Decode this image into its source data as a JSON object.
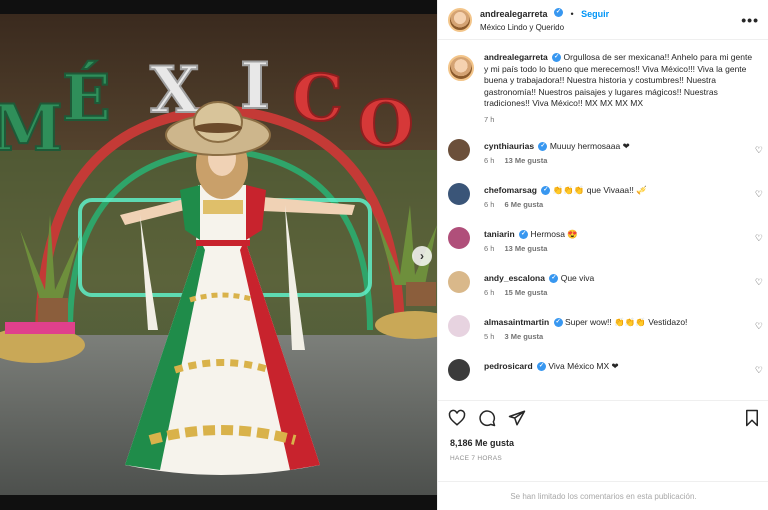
{
  "post": {
    "username": "andrealegarreta",
    "follow_label": "Seguir",
    "location": "México Lindo y Querido",
    "more_label": "•••",
    "carousel_next": "›"
  },
  "caption": {
    "username": "andrealegarreta",
    "text": "Orgullosa de ser mexicana!! Anhelo para mi gente y mi país todo lo bueno que merecemos!! Viva México!!! Viva la gente buena y trabajadora!! Nuestra historia y costumbres!! Nuestra gastronomía!! Nuestros paisajes y lugares mágicos!! Nuestras tradiciones!! Viva México!! MX MX MX MX",
    "time": "7 h"
  },
  "comments": [
    {
      "username": "cynthiaurias",
      "text": "Muuuy hermosaaa ❤",
      "time": "6 h",
      "likes": "13 Me gusta",
      "avatar_color": "#6b4f3a"
    },
    {
      "username": "chefomarsag",
      "text": "👏👏👏 que Vivaaa!! 🎺",
      "time": "6 h",
      "likes": "6 Me gusta",
      "avatar_color": "#3a5578"
    },
    {
      "username": "taniarin",
      "text": "Hermosa 😍",
      "time": "6 h",
      "likes": "13 Me gusta",
      "avatar_color": "#b04f7a"
    },
    {
      "username": "andy_escalona",
      "text": "Que viva",
      "time": "6 h",
      "likes": "15 Me gusta",
      "avatar_color": "#d9b88a"
    },
    {
      "username": "almasaintmartin",
      "text": "Super wow!! 👏👏👏 Vestidazo!",
      "time": "5 h",
      "likes": "3 Me gusta",
      "avatar_color": "#e7d3e0"
    },
    {
      "username": "pedrosicard",
      "text": "Viva México MX ❤",
      "time": "",
      "likes": "",
      "avatar_color": "#3b3b3b"
    }
  ],
  "actions": {
    "likes_count": "8,186 Me gusta",
    "time_ago": "HACE 7 HORAS",
    "comments_limited": "Se han limitado los comentarios en esta publicación."
  },
  "media": {
    "sign_letters": [
      "M",
      "É",
      "X",
      "I",
      "C",
      "O"
    ]
  },
  "colors": {
    "accent": "#0095f6",
    "verified": "#3897f0",
    "muted": "#737373"
  }
}
